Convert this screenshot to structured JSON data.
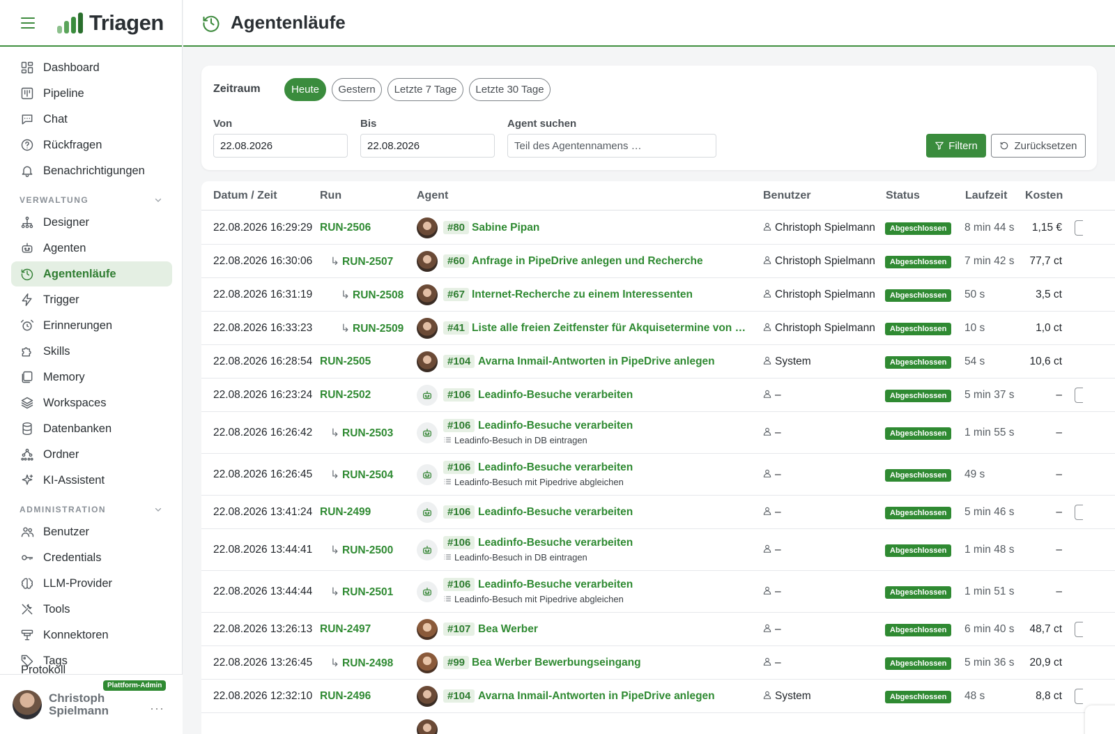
{
  "app": {
    "name": "Triagen",
    "page_title": "Agentenläufe",
    "brand_color": "#3a8c3d"
  },
  "sidebar": {
    "items": [
      {
        "label": "Dashboard",
        "icon": "dashboard-icon"
      },
      {
        "label": "Pipeline",
        "icon": "pipeline-icon"
      },
      {
        "label": "Chat",
        "icon": "chat-icon"
      },
      {
        "label": "Rückfragen",
        "icon": "question-icon"
      },
      {
        "label": "Benachrichtigungen",
        "icon": "bell-icon"
      }
    ],
    "section_verwaltung": "VERWALTUNG",
    "verwaltung_items": [
      {
        "label": "Designer",
        "icon": "designer-icon"
      },
      {
        "label": "Agenten",
        "icon": "robot-icon"
      },
      {
        "label": "Agentenläufe",
        "icon": "clock-icon",
        "active": true
      },
      {
        "label": "Trigger",
        "icon": "bolt-icon"
      },
      {
        "label": "Erinnerungen",
        "icon": "alarm-icon"
      },
      {
        "label": "Skills",
        "icon": "puzzle-icon"
      },
      {
        "label": "Memory",
        "icon": "memory-icon"
      },
      {
        "label": "Workspaces",
        "icon": "workspace-icon"
      },
      {
        "label": "Datenbanken",
        "icon": "database-icon"
      },
      {
        "label": "Ordner",
        "icon": "folder-tree-icon"
      },
      {
        "label": "KI-Assistent",
        "icon": "sparkle-icon"
      }
    ],
    "section_administration": "ADMINISTRATION",
    "administration_items": [
      {
        "label": "Benutzer",
        "icon": "users-icon"
      },
      {
        "label": "Credentials",
        "icon": "key-icon"
      },
      {
        "label": "LLM-Provider",
        "icon": "brain-icon"
      },
      {
        "label": "Tools",
        "icon": "tools-icon"
      },
      {
        "label": "Konnektoren",
        "icon": "connector-icon"
      },
      {
        "label": "Tags",
        "icon": "tag-icon"
      }
    ],
    "partial_item": "Protokoll",
    "user": {
      "name_line1": "Christoph",
      "name_line2": "Spielmann",
      "badge": "Plattform-Admin",
      "more": "···"
    }
  },
  "filter": {
    "zeitraum_label": "Zeitraum",
    "chips": [
      {
        "label": "Heute",
        "active": true
      },
      {
        "label": "Gestern",
        "active": false
      },
      {
        "label": "Letzte 7 Tage",
        "active": false
      },
      {
        "label": "Letzte 30 Tage",
        "active": false
      }
    ],
    "von_label": "Von",
    "von_value": "22.08.2026",
    "bis_label": "Bis",
    "bis_value": "22.08.2026",
    "agent_label": "Agent suchen",
    "agent_placeholder": "Teil des Agentennamens …",
    "filter_button": "Filtern",
    "reset_button": "Zurücksetzen"
  },
  "table": {
    "headers": [
      "Datum / Zeit",
      "Run",
      "Agent",
      "Benutzer",
      "Status",
      "Laufzeit",
      "Kosten"
    ],
    "rows": [
      {
        "date": "22.08.2026 16:29:29",
        "run": "RUN-2506",
        "child": 0,
        "avatar": "photo",
        "id": "#80",
        "agent": "Sabine Pipan",
        "sub": "",
        "user": "Christoph Spielmann",
        "status": "Abgeschlossen",
        "duration": "8 min 44 s",
        "cost": "1,15 €",
        "edge": true
      },
      {
        "date": "22.08.2026 16:30:06",
        "run": "RUN-2507",
        "child": 1,
        "avatar": "photo",
        "id": "#60",
        "agent": "Anfrage in PipeDrive anlegen und Recherche",
        "sub": "",
        "user": "Christoph Spielmann",
        "status": "Abgeschlossen",
        "duration": "7 min 42 s",
        "cost": "77,7 ct",
        "edge": false
      },
      {
        "date": "22.08.2026 16:31:19",
        "run": "RUN-2508",
        "child": 2,
        "avatar": "photo",
        "id": "#67",
        "agent": "Internet-Recherche zu einem Interessenten",
        "sub": "",
        "user": "Christoph Spielmann",
        "status": "Abgeschlossen",
        "duration": "50 s",
        "cost": "3,5 ct",
        "edge": false
      },
      {
        "date": "22.08.2026 16:33:23",
        "run": "RUN-2509",
        "child": 2,
        "avatar": "photo",
        "id": "#41",
        "agent": "Liste alle freien Zeitfenster für Akquisetermine von To...",
        "sub": "",
        "user": "Christoph Spielmann",
        "status": "Abgeschlossen",
        "duration": "10 s",
        "cost": "1,0 ct",
        "edge": false
      },
      {
        "date": "22.08.2026 16:28:54",
        "run": "RUN-2505",
        "child": 0,
        "avatar": "photo",
        "id": "#104",
        "agent": "Avarna Inmail-Antworten in PipeDrive anlegen",
        "sub": "",
        "user": "System",
        "status": "Abgeschlossen",
        "duration": "54 s",
        "cost": "10,6 ct",
        "edge": false
      },
      {
        "date": "22.08.2026 16:23:24",
        "run": "RUN-2502",
        "child": 0,
        "avatar": "bot",
        "id": "#106",
        "agent": "Leadinfo-Besuche verarbeiten",
        "sub": "",
        "user": "–",
        "status": "Abgeschlossen",
        "duration": "5 min 37 s",
        "cost": "–",
        "edge": true
      },
      {
        "date": "22.08.2026 16:26:42",
        "run": "RUN-2503",
        "child": 1,
        "avatar": "bot",
        "id": "#106",
        "agent": "Leadinfo-Besuche verarbeiten",
        "sub": "Leadinfo-Besuch in DB eintragen",
        "user": "–",
        "status": "Abgeschlossen",
        "duration": "1 min 55 s",
        "cost": "–",
        "edge": false
      },
      {
        "date": "22.08.2026 16:26:45",
        "run": "RUN-2504",
        "child": 1,
        "avatar": "bot",
        "id": "#106",
        "agent": "Leadinfo-Besuche verarbeiten",
        "sub": "Leadinfo-Besuch mit Pipedrive abgleichen",
        "user": "–",
        "status": "Abgeschlossen",
        "duration": "49 s",
        "cost": "–",
        "edge": false
      },
      {
        "date": "22.08.2026 13:41:24",
        "run": "RUN-2499",
        "child": 0,
        "avatar": "bot",
        "id": "#106",
        "agent": "Leadinfo-Besuche verarbeiten",
        "sub": "",
        "user": "–",
        "status": "Abgeschlossen",
        "duration": "5 min 46 s",
        "cost": "–",
        "edge": true
      },
      {
        "date": "22.08.2026 13:44:41",
        "run": "RUN-2500",
        "child": 1,
        "avatar": "bot",
        "id": "#106",
        "agent": "Leadinfo-Besuche verarbeiten",
        "sub": "Leadinfo-Besuch in DB eintragen",
        "user": "–",
        "status": "Abgeschlossen",
        "duration": "1 min 48 s",
        "cost": "–",
        "edge": false
      },
      {
        "date": "22.08.2026 13:44:44",
        "run": "RUN-2501",
        "child": 1,
        "avatar": "bot",
        "id": "#106",
        "agent": "Leadinfo-Besuche verarbeiten",
        "sub": "Leadinfo-Besuch mit Pipedrive abgleichen",
        "user": "–",
        "status": "Abgeschlossen",
        "duration": "1 min 51 s",
        "cost": "–",
        "edge": false
      },
      {
        "date": "22.08.2026 13:26:13",
        "run": "RUN-2497",
        "child": 0,
        "avatar": "photo2",
        "id": "#107",
        "agent": "Bea Werber",
        "sub": "",
        "user": "–",
        "status": "Abgeschlossen",
        "duration": "6 min 40 s",
        "cost": "48,7 ct",
        "edge": true
      },
      {
        "date": "22.08.2026 13:26:45",
        "run": "RUN-2498",
        "child": 1,
        "avatar": "photo2",
        "id": "#99",
        "agent": "Bea Werber Bewerbungseingang",
        "sub": "",
        "user": "–",
        "status": "Abgeschlossen",
        "duration": "5 min 36 s",
        "cost": "20,9 ct",
        "edge": false
      },
      {
        "date": "22.08.2026 12:32:10",
        "run": "RUN-2496",
        "child": 0,
        "avatar": "photo",
        "id": "#104",
        "agent": "Avarna Inmail-Antworten in PipeDrive anlegen",
        "sub": "",
        "user": "System",
        "status": "Abgeschlossen",
        "duration": "48 s",
        "cost": "8,8 ct",
        "edge": true
      }
    ]
  }
}
